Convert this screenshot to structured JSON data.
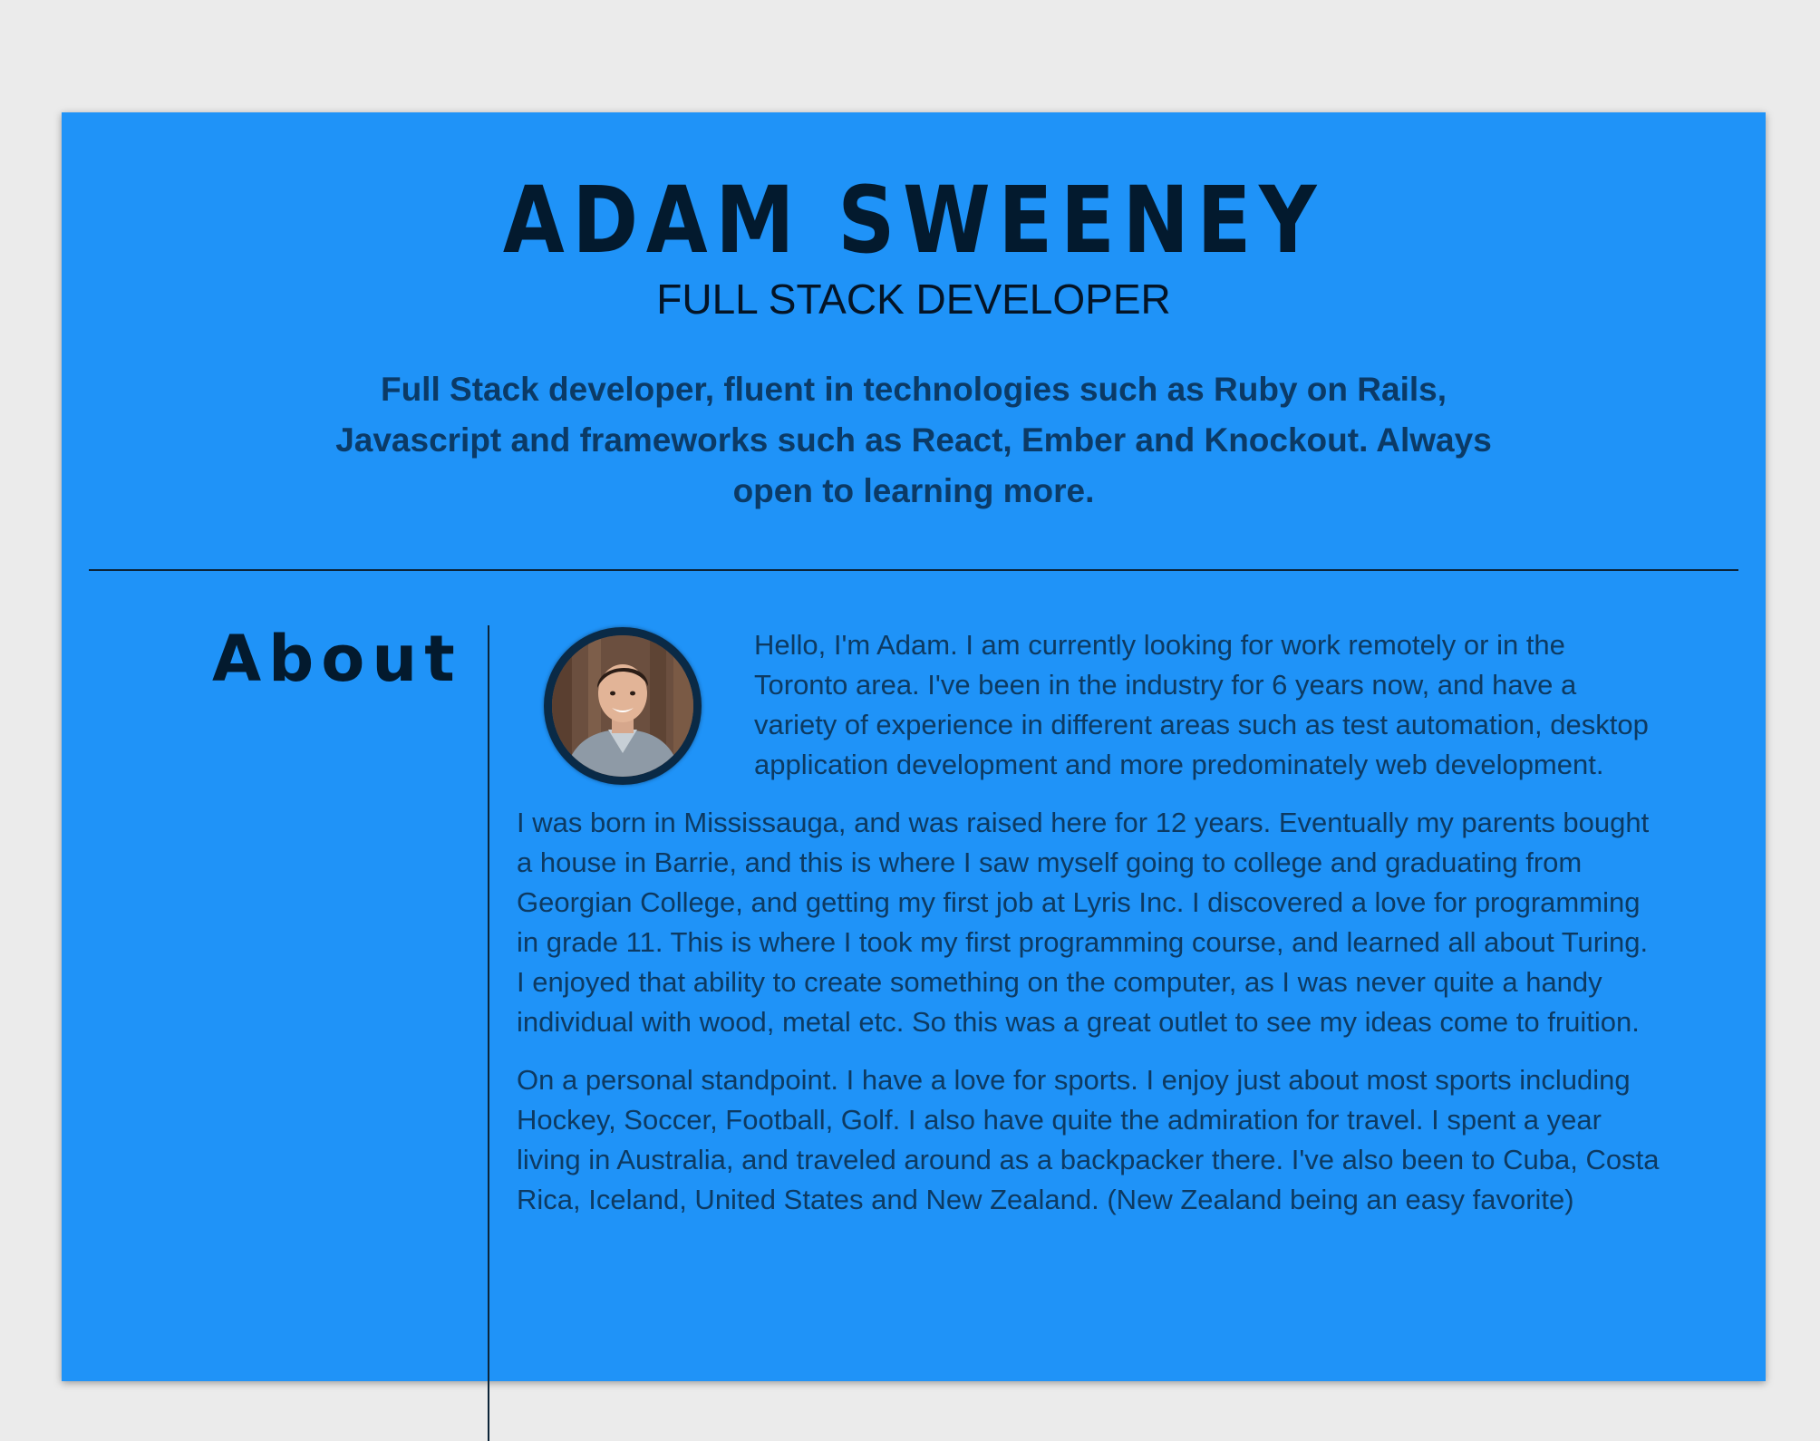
{
  "header": {
    "name": "ADAM SWEENEY",
    "job_title": "FULL STACK DEVELOPER",
    "summary": "Full Stack developer, fluent in technologies such as Ruby on Rails, Javascript and frameworks such as React, Ember and Knockout. Always open to learning more."
  },
  "about": {
    "heading": "About",
    "avatar_icon": "profile-photo",
    "paragraphs": [
      "Hello, I'm Adam. I am currently looking for work remotely or in the Toronto area. I've been in the industry for 6 years now, and have a variety of experience in different areas such as test automation, desktop application development and more predominately web development.",
      "I was born in Mississauga, and was raised here for 12 years. Eventually my parents bought a house in Barrie, and this is where I saw myself going to college and graduating from Georgian College, and getting my first job at Lyris Inc. I discovered a love for programming in grade 11. This is where I took my first programming course, and learned all about Turing. I enjoyed that ability to create something on the computer, as I was never quite a handy individual with wood, metal etc. So this was a great outlet to see my ideas come to fruition.",
      "On a personal standpoint. I have a love for sports. I enjoy just about most sports including Hockey, Soccer, Football, Golf. I also have quite the admiration for travel. I spent a year living in Australia, and traveled around as a backpacker there. I've also been to Cuba, Costa Rica, Iceland, United States and New Zealand. (New Zealand being an easy favorite)"
    ]
  },
  "colors": {
    "page_background": "#ebebeb",
    "sheet_background": "#1f93f8",
    "heading_text": "#031a2e",
    "body_text": "#0d3a62"
  }
}
